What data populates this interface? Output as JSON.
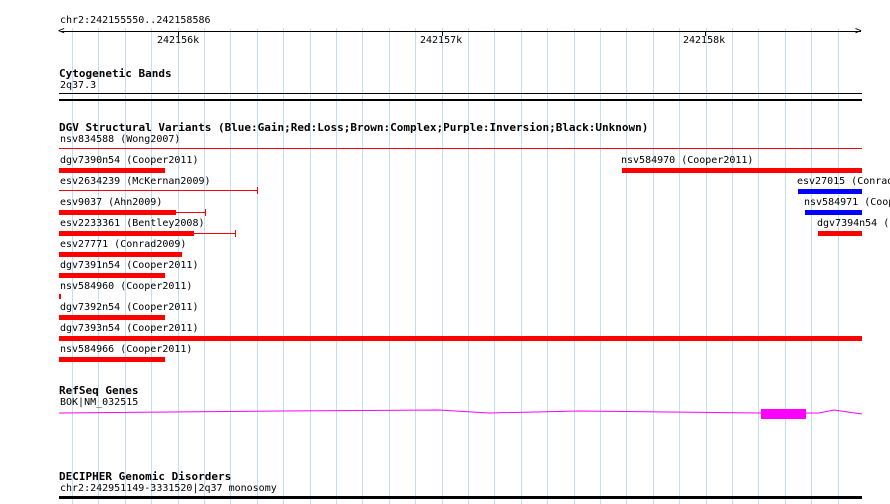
{
  "ruler": {
    "range": "chr2:242155550..242158586",
    "ticks": [
      "242156k",
      "242157k",
      "242158k"
    ]
  },
  "cyto": {
    "title": "Cytogenetic Bands",
    "band": "2q37.3"
  },
  "dgv": {
    "title": "DGV Structural Variants (Blue:Gain;Red:Loss;Brown:Complex;Purple:Inversion;Black:Unknown)",
    "colors": {
      "gain": "#0000ff",
      "loss": "#ff0000"
    },
    "items": [
      {
        "label": "nsv834588 (Wong2007)",
        "type": "loss"
      },
      {
        "label": "dgv7390n54 (Cooper2011)",
        "type": "loss"
      },
      {
        "label": "nsv584970 (Cooper2011)",
        "type": "loss"
      },
      {
        "label": "esv2634239 (McKernan2009)",
        "type": "loss"
      },
      {
        "label": "esv27015 (Conrad",
        "type": "gain"
      },
      {
        "label": "esv9037 (Ahn2009)",
        "type": "loss"
      },
      {
        "label": "nsv584971 (Coop",
        "type": "gain"
      },
      {
        "label": "esv2233361 (Bentley2008)",
        "type": "loss"
      },
      {
        "label": "dgv7394n54 (",
        "type": "loss"
      },
      {
        "label": "esv27771 (Conrad2009)",
        "type": "loss"
      },
      {
        "label": "dgv7391n54 (Cooper2011)",
        "type": "loss"
      },
      {
        "label": "nsv584960 (Cooper2011)",
        "type": "loss"
      },
      {
        "label": "dgv7392n54 (Cooper2011)",
        "type": "loss"
      },
      {
        "label": "dgv7393n54 (Cooper2011)",
        "type": "loss"
      },
      {
        "label": "nsv584966 (Cooper2011)",
        "type": "loss"
      }
    ]
  },
  "refseq": {
    "title": "RefSeq Genes",
    "gene": "BOK|NM_032515",
    "color": "#ff00ff"
  },
  "decipher": {
    "title": "DECIPHER Genomic Disorders",
    "item": "chr2:242951149-3331520|2q37 monosomy"
  }
}
